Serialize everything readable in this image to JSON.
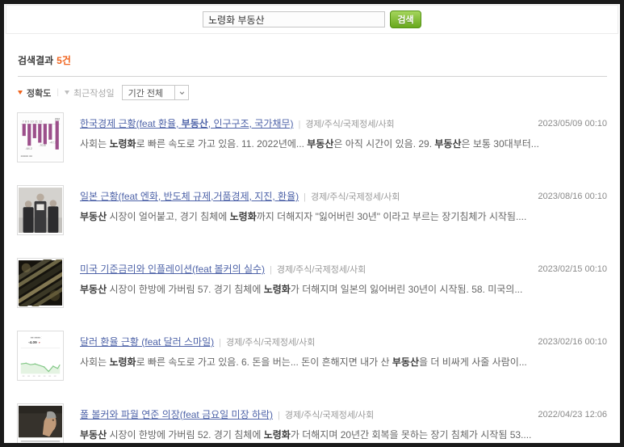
{
  "search": {
    "query": "노령화 부동산",
    "button_label": "검색"
  },
  "results_header": {
    "label": "검색결과",
    "count": "5건"
  },
  "sort": {
    "accuracy_label": "정확도",
    "recent_label": "최근작성일",
    "period_selected": "기간 전체"
  },
  "colors": {
    "accent_orange": "#f0641e",
    "button_green": "#68a81d",
    "button_green_border": "#559316",
    "link_blue": "#4e63a8",
    "frame_black": "#1a1a1a"
  },
  "results": [
    {
      "thumbnail": "bar-chart",
      "title_parts": [
        {
          "t": "한국경제 근황(feat 환율, ",
          "b": false
        },
        {
          "t": "부동산",
          "b": true
        },
        {
          "t": ", 인구구조, 국가채무)",
          "b": false
        }
      ],
      "category": "경제/주식/국제정세/사회",
      "date": "2023/05/09 00:10",
      "desc_parts": [
        {
          "t": "사회는 ",
          "b": false
        },
        {
          "t": "노령화",
          "b": true
        },
        {
          "t": "로 빠른 속도로 가고 있음. 11. 2022년에... ",
          "b": false
        },
        {
          "t": "부동산",
          "b": true
        },
        {
          "t": "은 아직 시간이 있음. 29. ",
          "b": false
        },
        {
          "t": "부동산",
          "b": true
        },
        {
          "t": "은 보통 30대부터...",
          "b": false
        }
      ]
    },
    {
      "thumbnail": "group-photo",
      "title_parts": [
        {
          "t": "일본 근황(feat 엔화, 반도체 규제,거품경제, 지진, 환율)",
          "b": false
        }
      ],
      "category": "경제/주식/국제정세/사회",
      "date": "2023/08/16 00:10",
      "desc_parts": [
        {
          "t": "부동산",
          "b": true
        },
        {
          "t": " 시장이 얼어붙고, 경기 침체에 ",
          "b": false
        },
        {
          "t": "노령화",
          "b": true
        },
        {
          "t": "까지 더해지자 \"잃어버린 30년\" 이라고 부르는 장기침체가 시작됨....",
          "b": false
        }
      ]
    },
    {
      "thumbnail": "money-dark",
      "title_parts": [
        {
          "t": "미국 기준금리와 인플레이션(feat 볼커의 실수)",
          "b": false
        }
      ],
      "category": "경제/주식/국제정세/사회",
      "date": "2023/02/15 00:10",
      "desc_parts": [
        {
          "t": "부동산",
          "b": true
        },
        {
          "t": " 시장이 한방에 가버림 57. 경기 침체에 ",
          "b": false
        },
        {
          "t": "노령화",
          "b": true
        },
        {
          "t": "가 더해지며 일본의 잃어버린 30년이 시작됨. 58. 미국의...",
          "b": false
        }
      ]
    },
    {
      "thumbnail": "line-chart",
      "title_parts": [
        {
          "t": "달러 환율 근황 (feat 달러 스마일)",
          "b": false
        }
      ],
      "category": "경제/주식/국제정세/사회",
      "date": "2023/02/16 00:10",
      "desc_parts": [
        {
          "t": "사회는 ",
          "b": false
        },
        {
          "t": "노령화",
          "b": true
        },
        {
          "t": "로 빠른 속도로 가고 있음. 6. 돈을 버는... 돈이 흔해지면 내가 산 ",
          "b": false
        },
        {
          "t": "부동산",
          "b": true
        },
        {
          "t": "을 더 비싸게 사줄 사람이...",
          "b": false
        }
      ]
    },
    {
      "thumbnail": "portrait-photo",
      "title_parts": [
        {
          "t": "폴 볼커와 파월 연준 의장(feat 금요일 미장 하락)",
          "b": false
        }
      ],
      "category": "경제/주식/국제정세/사회",
      "date": "2022/04/23 12:06",
      "desc_parts": [
        {
          "t": "부동산",
          "b": true
        },
        {
          "t": " 시장이 한방에 가버림 52. 경기 침체에 ",
          "b": false
        },
        {
          "t": "노령화",
          "b": true
        },
        {
          "t": "가 더해지며 20년간 회복을 못하는 장기 침체가 시작됨 53....",
          "b": false
        }
      ]
    }
  ]
}
